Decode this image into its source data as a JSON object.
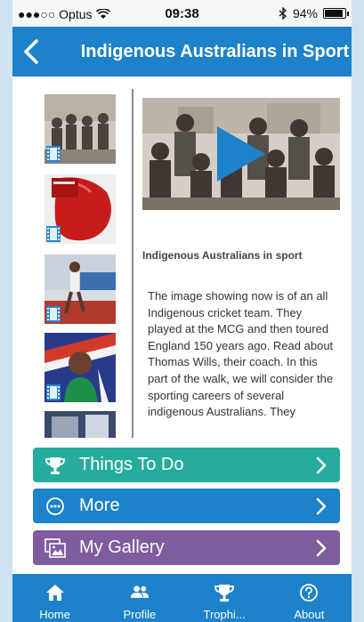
{
  "status_bar": {
    "carrier": "●●●○○ Optus",
    "time": "09:38",
    "battery": "94%"
  },
  "nav": {
    "title": "Indigenous Australians in Sport",
    "back_icon": "chevron-left-icon"
  },
  "media": {
    "thumbnails": [
      {
        "name": "thumb-cricket-team",
        "colors": [
          "#bfb6ac",
          "#6b6259"
        ]
      },
      {
        "name": "thumb-boxing-glove",
        "colors": [
          "#c71c1c",
          "#e9e9e9"
        ]
      },
      {
        "name": "thumb-athlete-track",
        "colors": [
          "#b03a2e",
          "#3a6fb0"
        ]
      },
      {
        "name": "thumb-athlete-flag",
        "colors": [
          "#2a3a8a",
          "#d23a2a"
        ]
      },
      {
        "name": "thumb-partial",
        "colors": [
          "#3b4a6a",
          "#9aa6b8"
        ]
      }
    ],
    "video_play_icon": "play-icon"
  },
  "article": {
    "heading": "Indigenous Australians in sport",
    "body": "The image showing now is of an all Indigenous cricket team. They played at the MCG and then toured England 150 years ago. Read about Thomas Wills, their coach. In this part of the walk, we will consider the sporting careers of several indigenous Australians. They"
  },
  "buttons": {
    "todo": {
      "label": "Things To Do",
      "icon": "trophy-icon"
    },
    "more": {
      "label": "More",
      "icon": "more-circle-icon"
    },
    "gallery": {
      "label": "My Gallery",
      "icon": "gallery-icon"
    }
  },
  "tabbar": [
    {
      "label": "Home",
      "icon": "home-icon"
    },
    {
      "label": "Profile",
      "icon": "users-icon"
    },
    {
      "label": "Trophi...",
      "icon": "trophy-icon"
    },
    {
      "label": "About",
      "icon": "question-circle-icon"
    }
  ],
  "colors": {
    "primary": "#1d82c9",
    "todo": "#26ac9c",
    "gallery": "#7e5c9d"
  }
}
